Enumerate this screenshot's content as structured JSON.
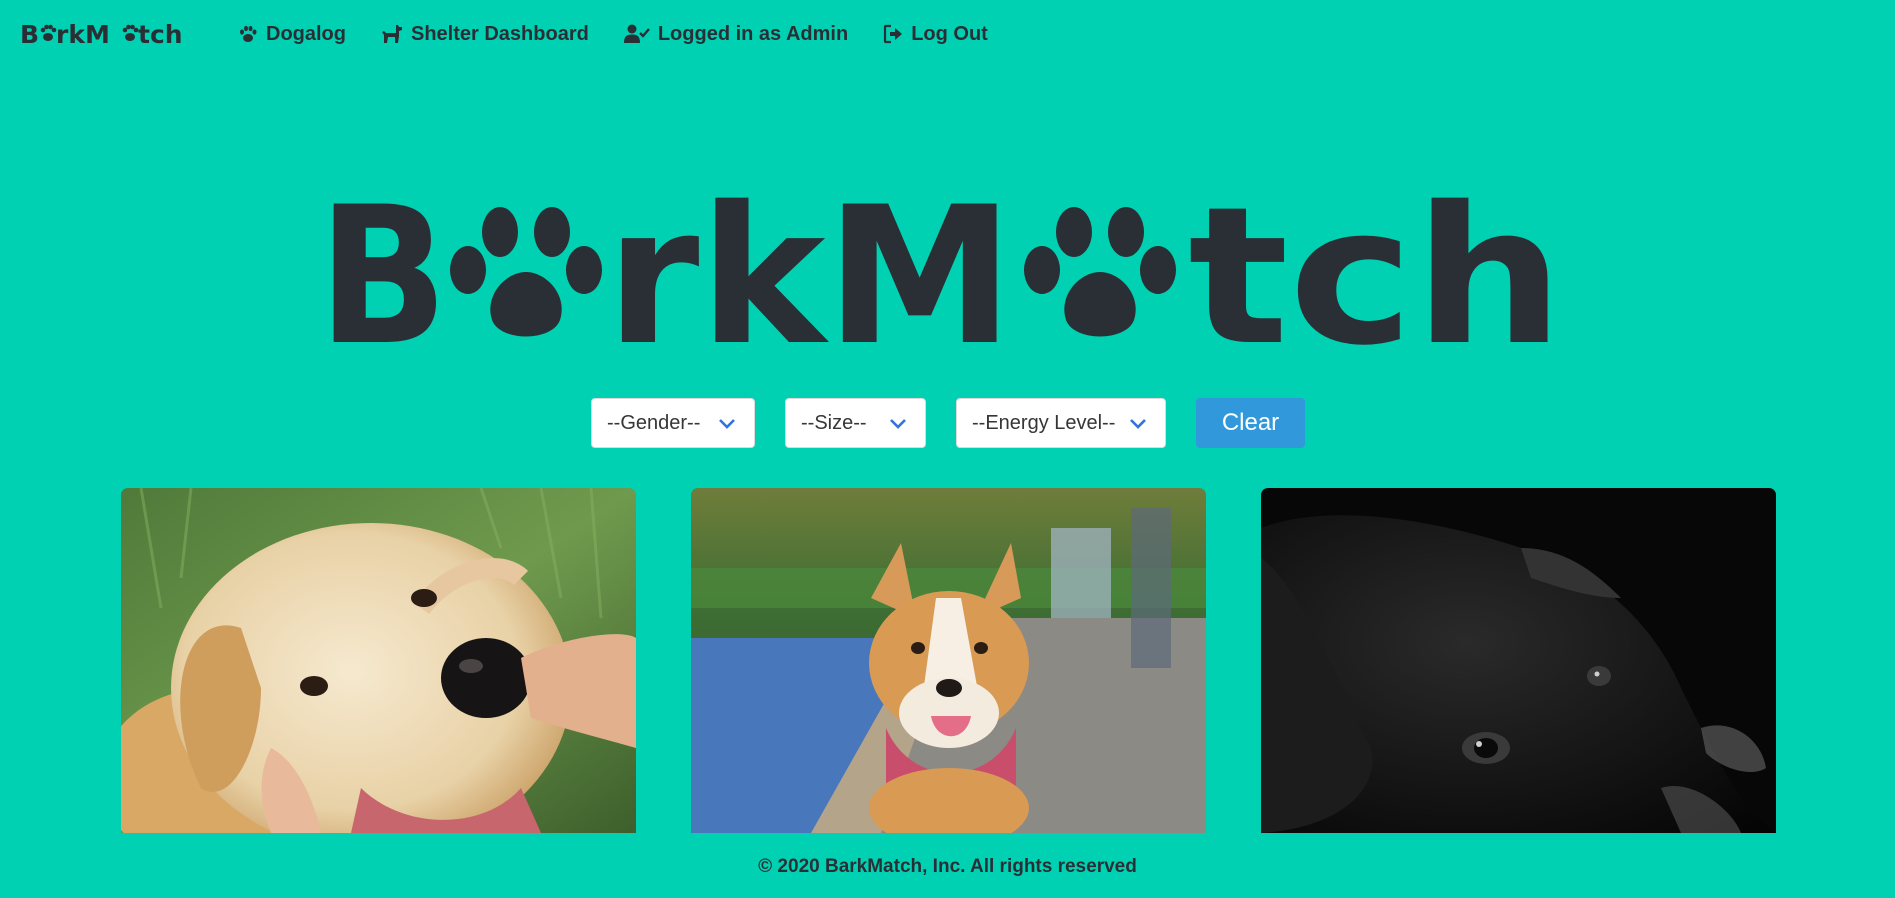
{
  "brand": {
    "name": "BarkMatch"
  },
  "nav": {
    "items": [
      {
        "label": "Dogalog",
        "icon": "paw-icon"
      },
      {
        "label": "Shelter Dashboard",
        "icon": "dog-icon"
      },
      {
        "label": "Logged in as Admin",
        "icon": "user-check-icon"
      },
      {
        "label": "Log Out",
        "icon": "sign-out-icon"
      }
    ]
  },
  "filters": {
    "gender": {
      "selected": "--Gender--",
      "options": [
        "--Gender--"
      ]
    },
    "size": {
      "selected": "--Size--",
      "options": [
        "--Size--"
      ]
    },
    "energy": {
      "selected": "--Energy Level--",
      "options": [
        "--Energy Level--"
      ]
    },
    "clear_label": "Clear"
  },
  "dogs": [
    {
      "photo": "golden-retriever-photo"
    },
    {
      "photo": "corgi-photo"
    },
    {
      "photo": "black-dog-photo"
    }
  ],
  "footer": {
    "text": "© 2020 BarkMatch, Inc. All rights reserved"
  },
  "colors": {
    "background": "#00d1b2",
    "text": "#2a2f36",
    "button": "#3298dc",
    "chevron": "#3273dc"
  }
}
